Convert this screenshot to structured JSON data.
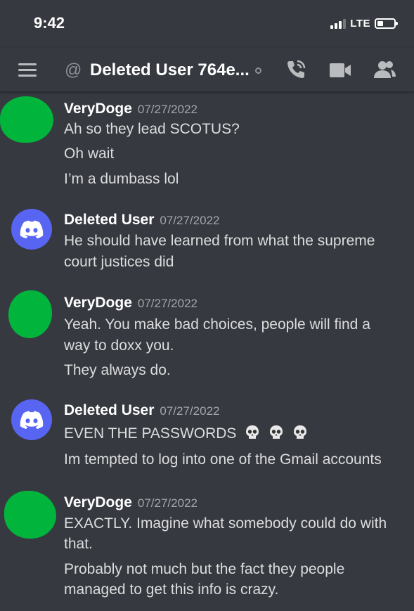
{
  "status_bar": {
    "time": "9:42",
    "network": "LTE"
  },
  "header": {
    "at_symbol": "@",
    "title": "Deleted User 764e..."
  },
  "icons": {
    "menu": "hamburger-menu-icon",
    "call": "phone-call-icon",
    "video": "video-camera-icon",
    "members": "members-icon"
  },
  "messages": [
    {
      "author": "VeryDoge",
      "date": "07/27/2022",
      "lines": [
        "Ah so they lead SCOTUS?",
        "Oh wait",
        "I’m a dumbass lol"
      ]
    },
    {
      "author": "Deleted User",
      "date": "07/27/2022",
      "lines": [
        "He should have learned from what the supreme",
        "court justices did"
      ]
    },
    {
      "author": "VeryDoge",
      "date": "07/27/2022",
      "lines": [
        "Yeah. You make bad choices, people will find a",
        "way to doxx you.",
        "They always do."
      ]
    },
    {
      "author": "Deleted User",
      "date": "07/27/2022",
      "lines": [
        "EVEN THE PASSWORDS",
        "Im tempted to log into one of the Gmail accounts"
      ]
    },
    {
      "author": "VeryDoge",
      "date": "07/27/2022",
      "lines": [
        "EXACTLY. Imagine what somebody could do with",
        "that.",
        "Probably not much but the fact they people",
        "managed to get this info is crazy."
      ]
    }
  ],
  "colors": {
    "background": "#36393f",
    "discord_blurple": "#5865f2",
    "censor_green": "#00b43c"
  }
}
